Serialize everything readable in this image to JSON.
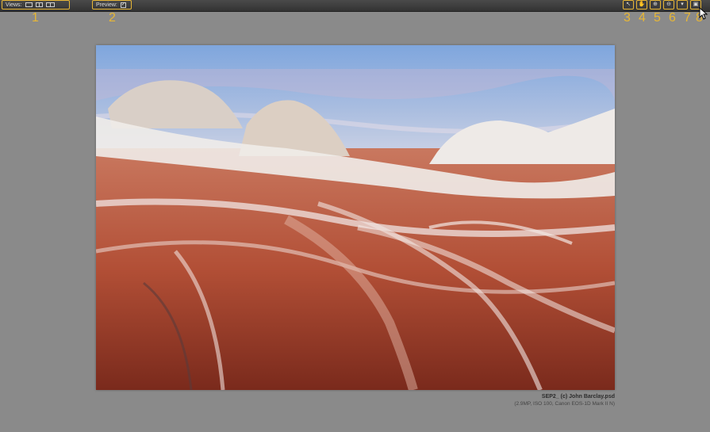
{
  "toolbar": {
    "views_label": "Views:",
    "preview_label": "Preview:",
    "preview_checked": "✓",
    "tools": [
      {
        "icon": "arrow-pointer-icon",
        "glyph": "↖"
      },
      {
        "icon": "hand-icon",
        "glyph": "✋"
      },
      {
        "icon": "zoom-in-icon",
        "glyph": "⊕"
      },
      {
        "icon": "zoom-out-icon",
        "glyph": "⊖"
      },
      {
        "icon": "eyedropper-icon",
        "glyph": "▾"
      },
      {
        "icon": "panel-icon",
        "glyph": "▣"
      }
    ]
  },
  "callouts": [
    "1",
    "2",
    "3",
    "4",
    "5",
    "6",
    "7",
    "8"
  ],
  "image": {
    "filename": "SEP2_ (c) John Barclay.psd",
    "meta": "(2.9MP, ISO 100, Canon EOS-1D Mark II N)"
  },
  "colors": {
    "accent": "#e7b636",
    "background": "#8a8a8a",
    "toolbar": "#3a3a3a"
  }
}
